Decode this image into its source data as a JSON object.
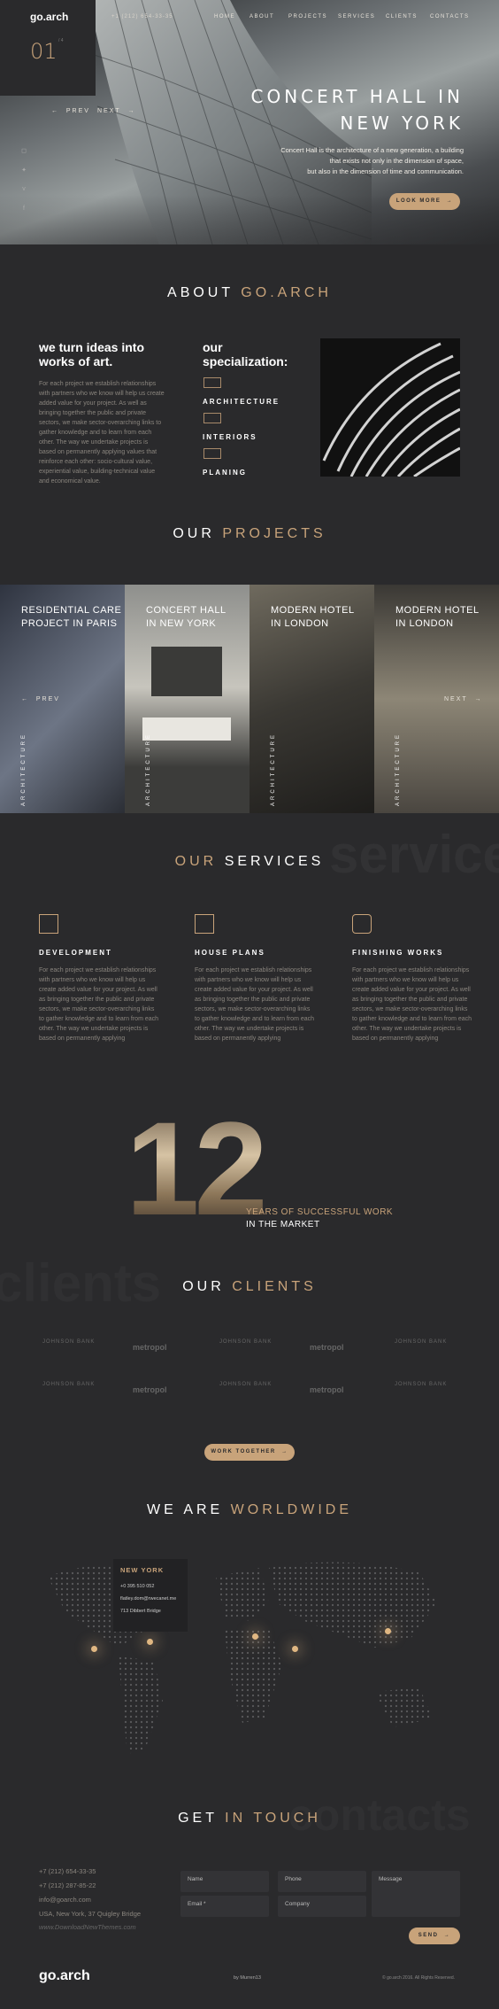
{
  "header": {
    "logo": "go.arch",
    "phone": "+1 (212) 654-33-35",
    "nav": [
      "HOME",
      "ABOUT",
      "PROJECTS",
      "SERVICES",
      "CLIENTS",
      "CONTACTS"
    ]
  },
  "hero": {
    "slide_number": "01",
    "slide_total": "/ 4",
    "prev": "PREV",
    "next": "NEXT",
    "title_line1": "CONCERT HALL IN",
    "title_line2": "NEW YORK",
    "desc_line1": "Concert Hall is the architecture of a new generation, a building",
    "desc_line2": "that exists not only in the dimension of space,",
    "desc_line3": "but also in the dimension of time and communication.",
    "button": "LOOK MORE",
    "socials": [
      "instagram-icon",
      "twitter-icon",
      "vimeo-icon",
      "facebook-icon"
    ]
  },
  "about": {
    "title": "ABOUT",
    "title_accent": "GO.ARCH",
    "heading_line1": "we turn ideas into",
    "heading_line2": "works of art.",
    "body": "For each project we establish relationships with partners who we know will help us create added value for your project. As well as bringing together the public and private sectors, we make sector-overarching links to gather knowledge and to learn from each other. The way we undertake projects is based on permanently applying values that reinforce each other: socio-cultural value, experiential value, building-technical value and economical value.",
    "spec_heading_line1": "our",
    "spec_heading_line2": "specialization:",
    "specializations": [
      "ARCHITECTURE",
      "INTERIORS",
      "PLANING"
    ]
  },
  "projects": {
    "title": "OUR",
    "title_accent": "PROJECTS",
    "items": [
      {
        "line1": "RESIDENTIAL CARE",
        "line2": "PROJECT IN PARIS",
        "category": "ARCHITECTURE"
      },
      {
        "line1": "CONCERT HALL",
        "line2": "IN NEW YORK",
        "category": "ARCHITECTURE"
      },
      {
        "line1": "MODERN HOTEL",
        "line2": "IN LONDON",
        "category": "ARCHITECTURE"
      },
      {
        "line1": "MODERN HOTEL",
        "line2": "IN LONDON",
        "category": "ARCHITECTURE"
      }
    ],
    "prev": "PREV",
    "next": "NEXT"
  },
  "services": {
    "title_accent": "OUR",
    "title": "SERVICES",
    "watermark": "services",
    "items": [
      {
        "name": "DEVELOPMENT",
        "icon": "ruler-icon",
        "text": "For each project we establish relationships with partners who we know will help us create added value for your project. As well as bringing together the public and private sectors, we make sector-overarching links to gather knowledge and to learn from each other. The way we undertake projects is based on permanently applying"
      },
      {
        "name": "HOUSE PLANS",
        "icon": "floorplan-icon",
        "text": "For each project we establish relationships with partners who we know will help us create added value for your project. As well as bringing together the public and private sectors, we make sector-overarching links to gather knowledge and to learn from each other. The way we undertake projects is based on permanently applying"
      },
      {
        "name": "FINISHING WORKS",
        "icon": "paint-roller-icon",
        "text": "For each project we establish relationships with partners who we know will help us create added value for your project. As well as bringing together the public and private sectors, we make sector-overarching links to gather knowledge and to learn from each other. The way we undertake projects is based on permanently applying"
      }
    ]
  },
  "years": {
    "number": "12",
    "line1": "YEARS OF SUCCESSFUL WORK",
    "line2": "IN THE MARKET"
  },
  "clients": {
    "title": "OUR",
    "title_accent": "CLIENTS",
    "watermark": "clients",
    "logos": [
      "JOHNSON BANK",
      "metropol",
      "JOHNSON BANK",
      "metropol",
      "JOHNSON BANK",
      "JOHNSON BANK",
      "metropol",
      "JOHNSON BANK",
      "metropol",
      "JOHNSON BANK"
    ],
    "button": "WORK TOGETHER"
  },
  "worldwide": {
    "title": "WE ARE",
    "title_accent": "WORLDWIDE",
    "office_city": "NEW YORK",
    "office_phone": "+0 395 510 052",
    "office_email": "flatley.dom@rwecanet.me",
    "office_address": "713 Dibbert Bridge"
  },
  "contact": {
    "title": "GET",
    "title_accent": "IN TOUCH",
    "watermark": "contacts",
    "phone1": "+7 (212) 654-33-35",
    "phone2": "+7 (212) 287-85-22",
    "email": "info@goarch.com",
    "address": "USA, New York, 37 Quigley Bridge",
    "watermark_site": "www.DownloadNewThemes.com",
    "fields": {
      "name": "Name",
      "phone": "Phone",
      "message": "Message",
      "email": "Email *",
      "company": "Company"
    },
    "send": "SEND"
  },
  "footer": {
    "logo": "go.arch",
    "credit": "by Murren13",
    "copyright": "© go.arch 2016. All Rights Reserved."
  },
  "colors": {
    "background": "#2a2a2c",
    "accent": "#c8a37a",
    "text": "#d8d3ca"
  }
}
